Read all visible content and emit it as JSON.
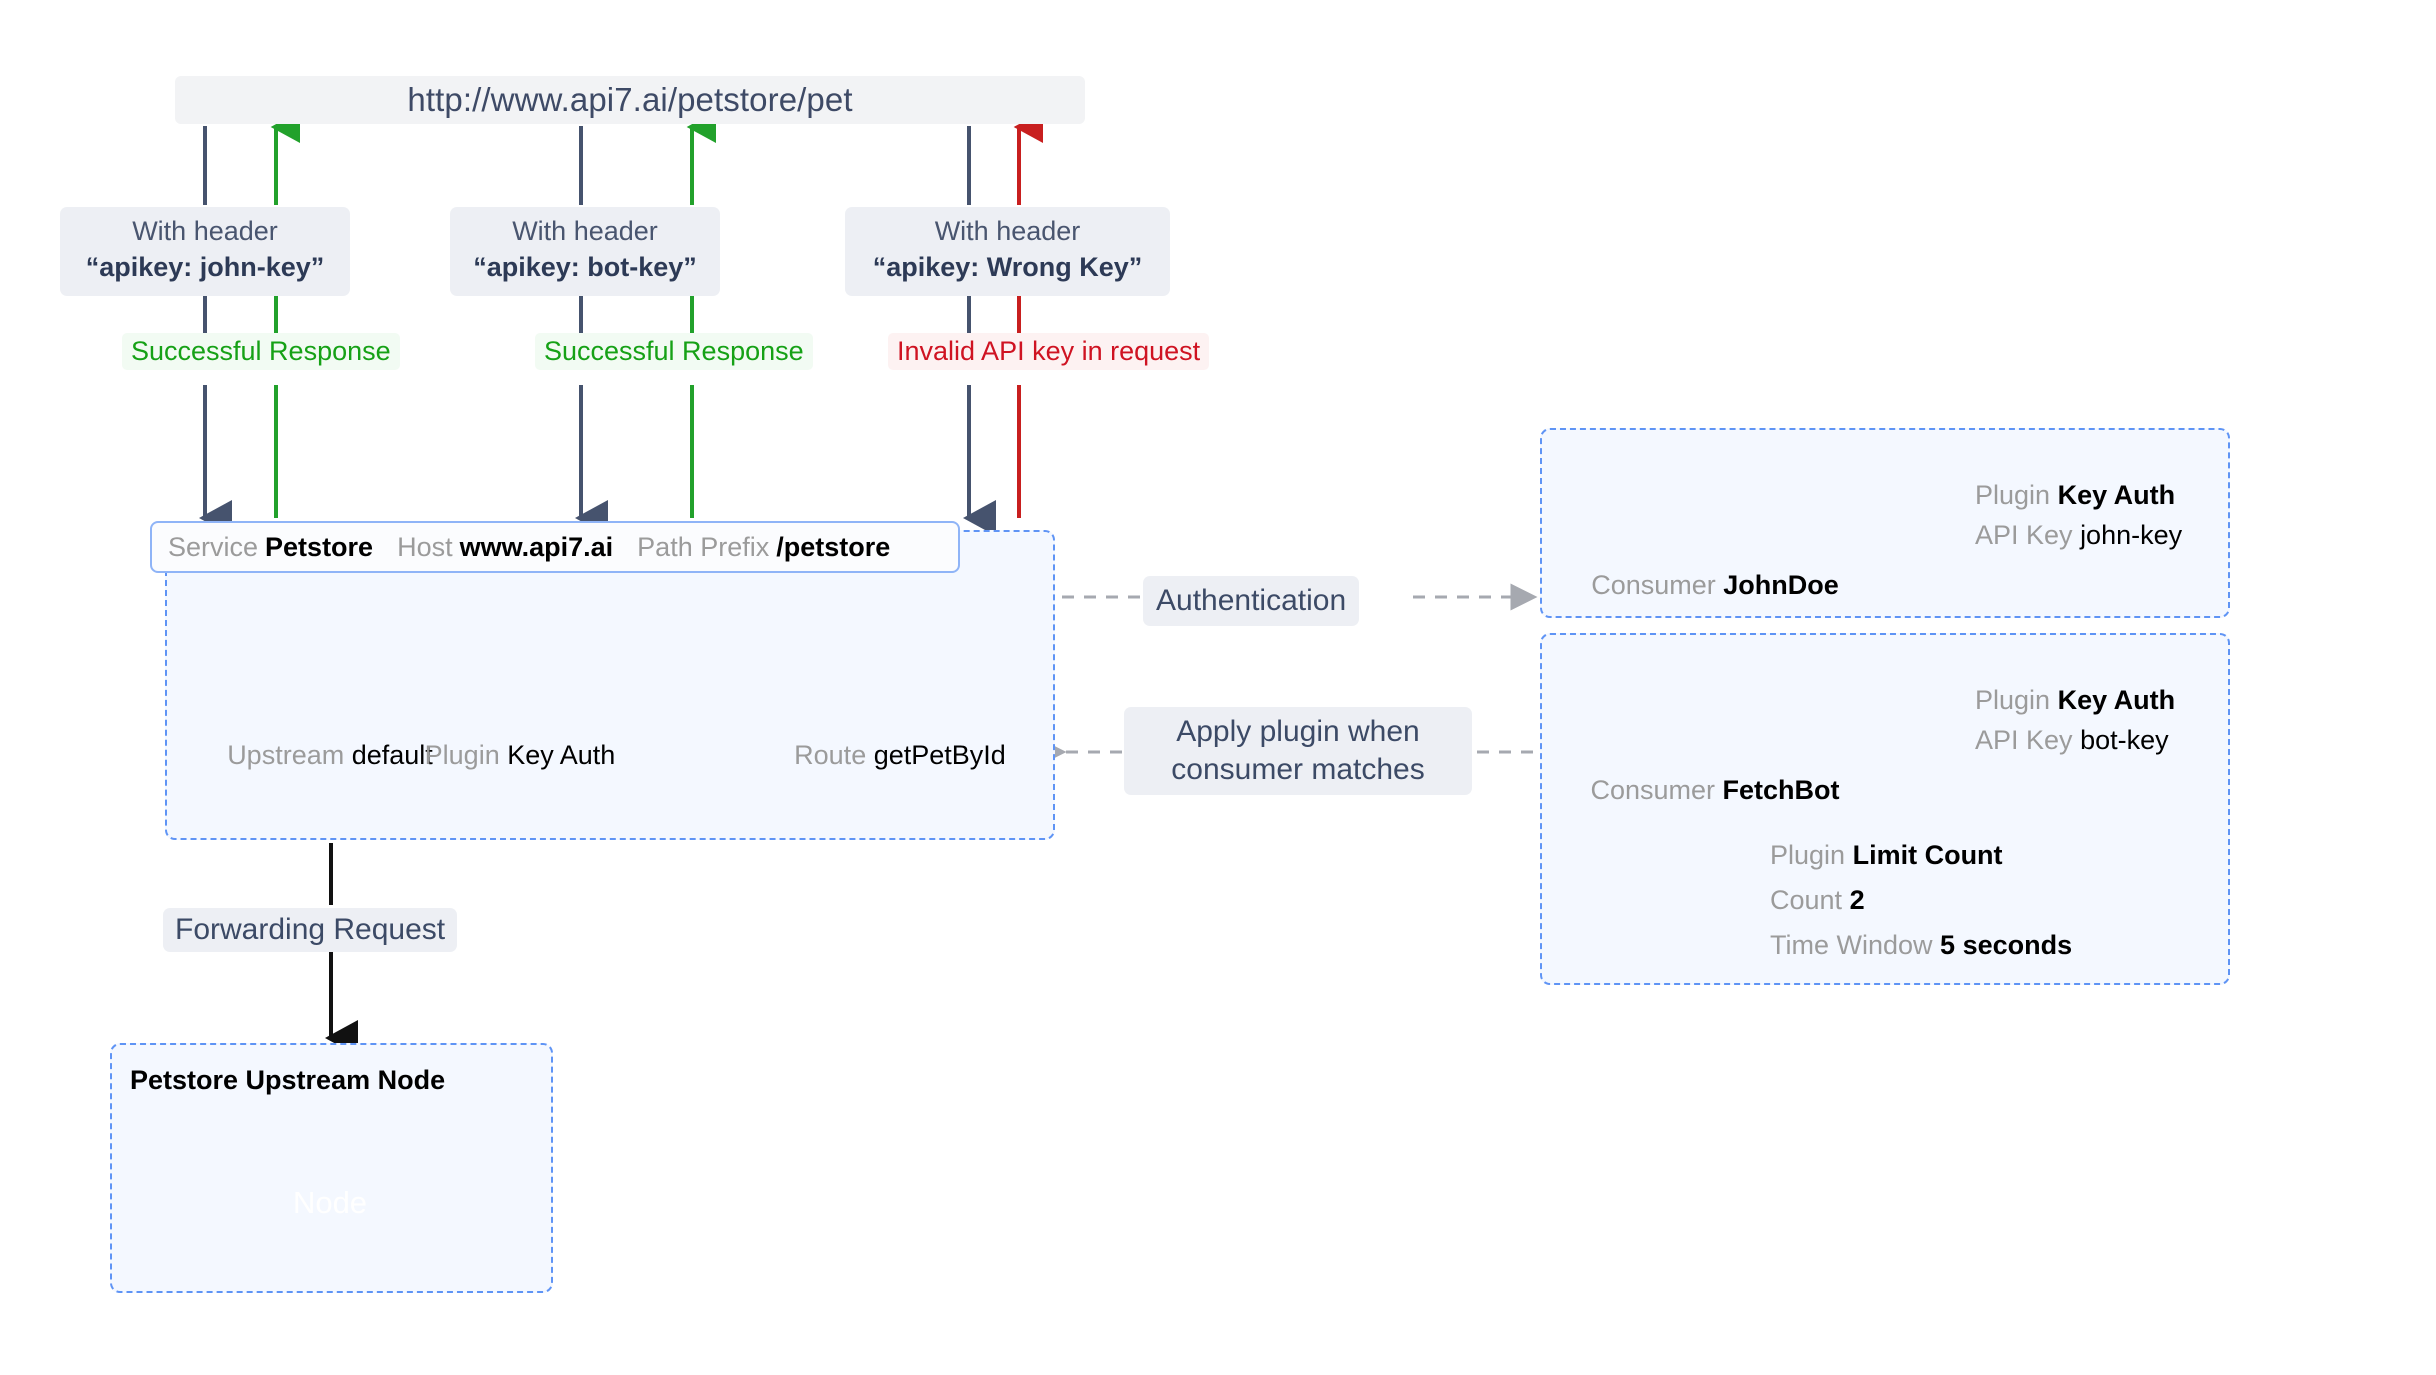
{
  "colors": {
    "request_arrow": "#46536e",
    "success_arrow": "#22a12b",
    "error_arrow": "#c81f1f",
    "dashed_blue": "#5f94f5",
    "panel_bg": "#f4f8ff",
    "chip_bg": "#edeff4",
    "success_text": "#16a116",
    "error_text": "#cf1322",
    "key_gray": "#9b9b9b",
    "node_blue": "#6b9cf5",
    "accent_orange": "#f7a95c"
  },
  "url_banner": {
    "text": "http://www.api7.ai/petstore/pet"
  },
  "flows": [
    {
      "id": "john",
      "header_line1": "With header",
      "header_line2": "“apikey: john-key”",
      "response_label": "Successful Response",
      "response_kind": "success"
    },
    {
      "id": "bot",
      "header_line1": "With header",
      "header_line2": "“apikey: bot-key”",
      "response_label": "Successful Response",
      "response_kind": "success"
    },
    {
      "id": "wrong",
      "header_line1": "With header",
      "header_line2": "“apikey: Wrong Key”",
      "response_label": "Invalid API key in request",
      "response_kind": "error"
    }
  ],
  "service": {
    "bar": [
      {
        "key": "Service",
        "value": "Petstore"
      },
      {
        "key": "Host",
        "value": "www.api7.ai"
      },
      {
        "key": "Path Prefix",
        "value": "/petstore"
      }
    ],
    "items": [
      {
        "icon": "upstream-icon",
        "key": "Upstream",
        "value": "default"
      },
      {
        "icon": "key-icon",
        "key": "Plugin",
        "value": "Key Auth"
      },
      {
        "icon": "route-icon",
        "key": "Route",
        "value": "getPetById"
      }
    ]
  },
  "connectors": {
    "authentication": "Authentication",
    "apply_plugin_line1": "Apply plugin when",
    "apply_plugin_line2": "consumer matches",
    "forwarding": "Forwarding Request"
  },
  "consumers": [
    {
      "icon": "users-icon",
      "key": "Consumer",
      "value": "JohnDoe",
      "plugins": [
        {
          "icon": "key-icon",
          "rows": [
            {
              "key": "Plugin",
              "value": "Key Auth"
            },
            {
              "key": "API Key",
              "value": "john-key"
            }
          ]
        }
      ]
    },
    {
      "icon": "users-icon",
      "key": "Consumer",
      "value": "FetchBot",
      "plugins": [
        {
          "icon": "key-icon",
          "rows": [
            {
              "key": "Plugin",
              "value": "Key Auth"
            },
            {
              "key": "API Key",
              "value": "bot-key"
            }
          ]
        },
        {
          "icon": "limit-count-icon",
          "rows": [
            {
              "key": "Plugin",
              "value": "Limit Count"
            },
            {
              "key": "Count",
              "value": "2"
            },
            {
              "key": "Time Window",
              "value": "5 seconds"
            }
          ]
        }
      ]
    }
  ],
  "upstream": {
    "title": "Petstore Upstream Node",
    "node_label": "Node"
  }
}
